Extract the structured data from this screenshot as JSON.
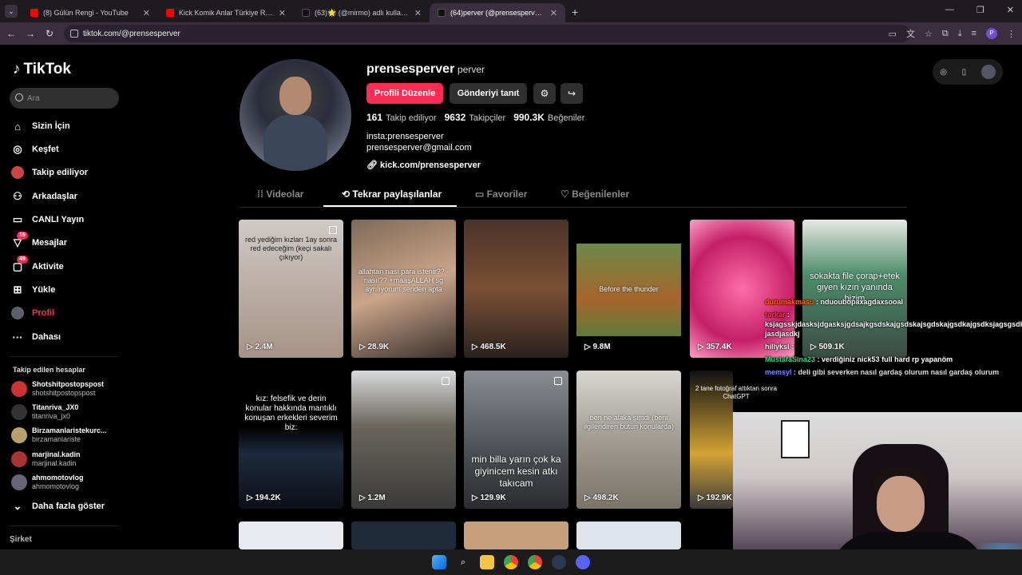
{
  "browser": {
    "tabs": [
      {
        "title": "(8) Gülün Rengi - YouTube",
        "color": "#ff0000",
        "active": false
      },
      {
        "title": "Kick Komik Anlar Türkiye Rewin",
        "color": "#ff0000",
        "active": false
      },
      {
        "title": "(63)🌟 (@mirmo) adlı kullanıcı",
        "color": "#111111",
        "active": false
      },
      {
        "title": "(64)perver (@prensesperver) | T",
        "color": "#111111",
        "active": true
      }
    ],
    "url": "tiktok.com/@prensesperver",
    "profile_initial": "P"
  },
  "sidebar": {
    "logo": "TikTok",
    "search_placeholder": "Ara",
    "menu": [
      {
        "label": "Sizin İçin",
        "icon": "home-icon",
        "glyph": "⌂",
        "badge": ""
      },
      {
        "label": "Keşfet",
        "icon": "compass-icon",
        "glyph": "◎",
        "badge": ""
      },
      {
        "label": "Takip ediliyor",
        "icon": "following-icon",
        "glyph": "●",
        "badge": ""
      },
      {
        "label": "Arkadaşlar",
        "icon": "friends-icon",
        "glyph": "⚇",
        "badge": ""
      },
      {
        "label": "CANLI Yayın",
        "icon": "live-icon",
        "glyph": "▭",
        "badge": ""
      },
      {
        "label": "Mesajlar",
        "icon": "message-icon",
        "glyph": "▽",
        "badge": "15"
      },
      {
        "label": "Aktivite",
        "icon": "activity-icon",
        "glyph": "▢",
        "badge": "49"
      },
      {
        "label": "Yükle",
        "icon": "upload-icon",
        "glyph": "⊞",
        "badge": ""
      },
      {
        "label": "Profil",
        "icon": "profile-icon",
        "glyph": "●",
        "badge": ""
      },
      {
        "label": "Dahası",
        "icon": "more-icon",
        "glyph": "···",
        "badge": ""
      }
    ],
    "followed_title": "Takip edilen hesaplar",
    "followed": [
      {
        "name": "Shotshitpostopspost",
        "handle": "shotshitpostopspost",
        "color": "#c33"
      },
      {
        "name": "Titanriva_JX0",
        "handle": "titanriva_jx0",
        "color": "#333"
      },
      {
        "name": "Birzamanlaristekurc...",
        "handle": "birzamanlariste",
        "color": "#b9a06a"
      },
      {
        "name": "marjinal.kadin",
        "handle": "marjinal.kadin",
        "color": "#a33"
      },
      {
        "name": "ahmomotovlog",
        "handle": "ahmomotovlog",
        "color": "#667"
      }
    ],
    "show_more": "Daha fazla göster",
    "company": "Şirket"
  },
  "profile": {
    "username": "prensesperver",
    "nickname": "perver",
    "edit_button": "Profili Düzenle",
    "promote_button": "Gönderiyi tanıt",
    "following_count": "161",
    "following_label": "Takip ediliyor",
    "followers_count": "9632",
    "followers_label": "Takipçiler",
    "likes_count": "990.3K",
    "likes_label": "Beğeniler",
    "bio_line1": "insta:prensesperver",
    "bio_line2": "prensesperver@gmail.com",
    "link": "kick.com/prensesperver"
  },
  "profile_tabs": [
    {
      "label": "Videolar",
      "active": false
    },
    {
      "label": "Tekrar paylaşılanlar",
      "active": true
    },
    {
      "label": "Favoriler",
      "active": false
    },
    {
      "label": "Beğenilenler",
      "active": false
    }
  ],
  "videos": [
    {
      "caption": "red yediğim kızları 1ay sonra red edeceğim (keçi sakalı çıkıyor)",
      "views": "2.4M",
      "bg": "#b7b1ab"
    },
    {
      "caption": "allahtan nası para istenir?? -nasıl?? +maaşALLAH sg ayrılıyorum senden apta",
      "views": "28.9K",
      "bg": "#5a4a40"
    },
    {
      "caption": "",
      "views": "468.5K",
      "bg": "#3a2a22"
    },
    {
      "caption": "Before the thunder",
      "views": "9.8M",
      "bg": "#4f6b3a"
    },
    {
      "caption": "",
      "views": "357.4K",
      "bg": "#d8306f"
    },
    {
      "caption": "sokakta file çorap+etek giyen kızın yanında bizim",
      "views": "509.1K",
      "bg": "#6a7d76"
    },
    {
      "caption": "kız: felsefik ve derin konular hakkında mantıklı konuşan erkekleri severim biz:",
      "views": "194.2K",
      "bg": "#1b2233"
    },
    {
      "caption": "",
      "views": "1.2M",
      "bg": "#6f6a5f"
    },
    {
      "caption": "min billa yarın çok ka giyinicem kesin atkı takıcam",
      "views": "129.9K",
      "bg": "#55585e"
    },
    {
      "caption": "ben ne alaka şimdi (beni ilgilendiren bütün konularda)",
      "views": "498.2K",
      "bg": "#8a8680"
    },
    {
      "caption": "2 tane fotoğraf attıktan sonra ChatGPT",
      "views": "192.9K",
      "bg": "#7a6a3a"
    }
  ],
  "chat_overlay": [
    {
      "user": "durumakmasu",
      "text": ": nduoubopaxagdaxsooal",
      "color": "#ff6a00"
    },
    {
      "user": "torkar",
      "text": ": ksjagsskjdasksjdgasksjgdsajkgsdskajgsdskajsgdskajgsdkajgsdksjagsgsdk jasdjasdkj",
      "color": "#ff3a3a"
    },
    {
      "user": "hillyksl",
      "text": ":",
      "color": "#ffffff"
    },
    {
      "user": "MustafaSina23",
      "text": ": verdiğiniz nick53 full hard rp yapanöm",
      "color": "#41d37b"
    },
    {
      "user": "memsyl",
      "text": ": deli gibi severken nasıl gardaş olurum nasıl gardaş olurum",
      "color": "#7a8cff"
    }
  ],
  "colors": {
    "accent": "#fe2c55",
    "bg": "#000000"
  }
}
